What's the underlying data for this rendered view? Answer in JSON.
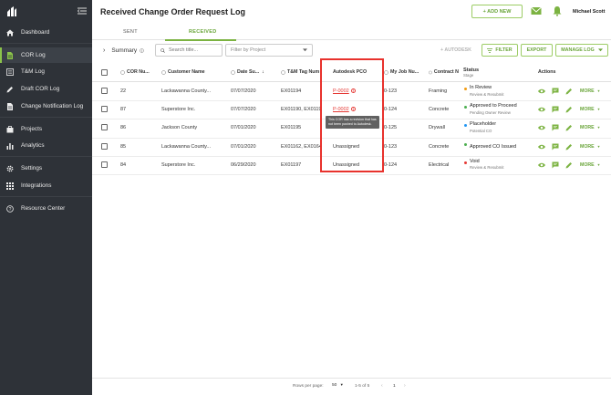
{
  "sidebar": {
    "items": [
      {
        "label": "Dashboard",
        "icon": "home-icon"
      },
      {
        "label": "COR Log",
        "icon": "document-icon"
      },
      {
        "label": "T&M Log",
        "icon": "list-icon"
      },
      {
        "label": "Draft COR Log",
        "icon": "pencil-icon"
      },
      {
        "label": "Change Notification Log",
        "icon": "document-icon"
      },
      {
        "label": "Projects",
        "icon": "briefcase-icon"
      },
      {
        "label": "Analytics",
        "icon": "bar-chart-icon"
      },
      {
        "label": "Settings",
        "icon": "gear-icon"
      },
      {
        "label": "Integrations",
        "icon": "grid-icon"
      },
      {
        "label": "Resource Center",
        "icon": "help-icon"
      }
    ]
  },
  "header": {
    "title": "Received Change Order Request Log",
    "add_new": "+ ADD NEW",
    "user": "Michael Scott"
  },
  "tabs": {
    "sent": "SENT",
    "received": "RECEIVED"
  },
  "toolbar": {
    "summary": "Summary",
    "search_placeholder": "Search title...",
    "filter_project": "Filter by Project",
    "autodesk": "+ AUTODESK",
    "filter": "FILTER",
    "export": "EXPORT",
    "manage_log": "MANAGE LOG"
  },
  "columns": {
    "cor_num": "COR Nu...",
    "customer": "Customer Name",
    "date": "Date Su...",
    "tm_tag": "T&M Tag Num",
    "autodesk_pco": "Autodesk PCO",
    "job_num": "My Job Nu...",
    "contract": "Contract N",
    "status": "Status",
    "stage": "Stage",
    "actions": "Actions"
  },
  "rows": [
    {
      "cor": "22",
      "customer": "Lackawanna County...",
      "date": "07/07/2020",
      "tag": "EX01194",
      "pco": "P-0002",
      "pco_link": true,
      "job": "0-123",
      "contract": "Framing",
      "status": "In Review",
      "stage": "Review & Resubmit",
      "dot": "#f39c12",
      "more": "MORE"
    },
    {
      "cor": "87",
      "customer": "Superstore Inc.",
      "date": "07/07/2020",
      "tag": "EX01190, EX0119",
      "pco": "P-0002",
      "pco_link": true,
      "job": "0-124",
      "contract": "Concrete",
      "status": "Approved to Proceed",
      "stage": "Pending Owner Review",
      "dot": "#4caf50",
      "more": "MORE"
    },
    {
      "cor": "86",
      "customer": "Jackson County",
      "date": "07/01/2020",
      "tag": "EX01195",
      "pco": "",
      "pco_link": false,
      "job": "0-125",
      "contract": "Drywall",
      "status": "Placeholder",
      "stage": "Potential CO",
      "dot": "#2196f3",
      "more": "MORE"
    },
    {
      "cor": "85",
      "customer": "Lackawanna County...",
      "date": "07/01/2020",
      "tag": "EX01162, EX0164",
      "pco": "Unassigned",
      "pco_link": false,
      "job": "0-123",
      "contract": "Concrete",
      "status": "Approved CO Issued",
      "stage": "",
      "dot": "#4caf50",
      "more": "MORE"
    },
    {
      "cor": "84",
      "customer": "Superstore Inc.",
      "date": "06/29/2020",
      "tag": "EX01197",
      "pco": "Unassigned",
      "pco_link": false,
      "job": "0-124",
      "contract": "Electrical",
      "status": "Void",
      "stage": "Review & Resubmit",
      "dot": "#e53935",
      "more": "MORE"
    }
  ],
  "tooltip": "This COR has a revision that has not been pushed to Autodesk.",
  "footer": {
    "rows_per_page": "Rows per page:",
    "rows_value": "50",
    "range": "1-5 of 5",
    "page": "1"
  },
  "colors": {
    "accent": "#7cb342",
    "sidebar": "#2e3238",
    "highlight": "#e8322d"
  }
}
